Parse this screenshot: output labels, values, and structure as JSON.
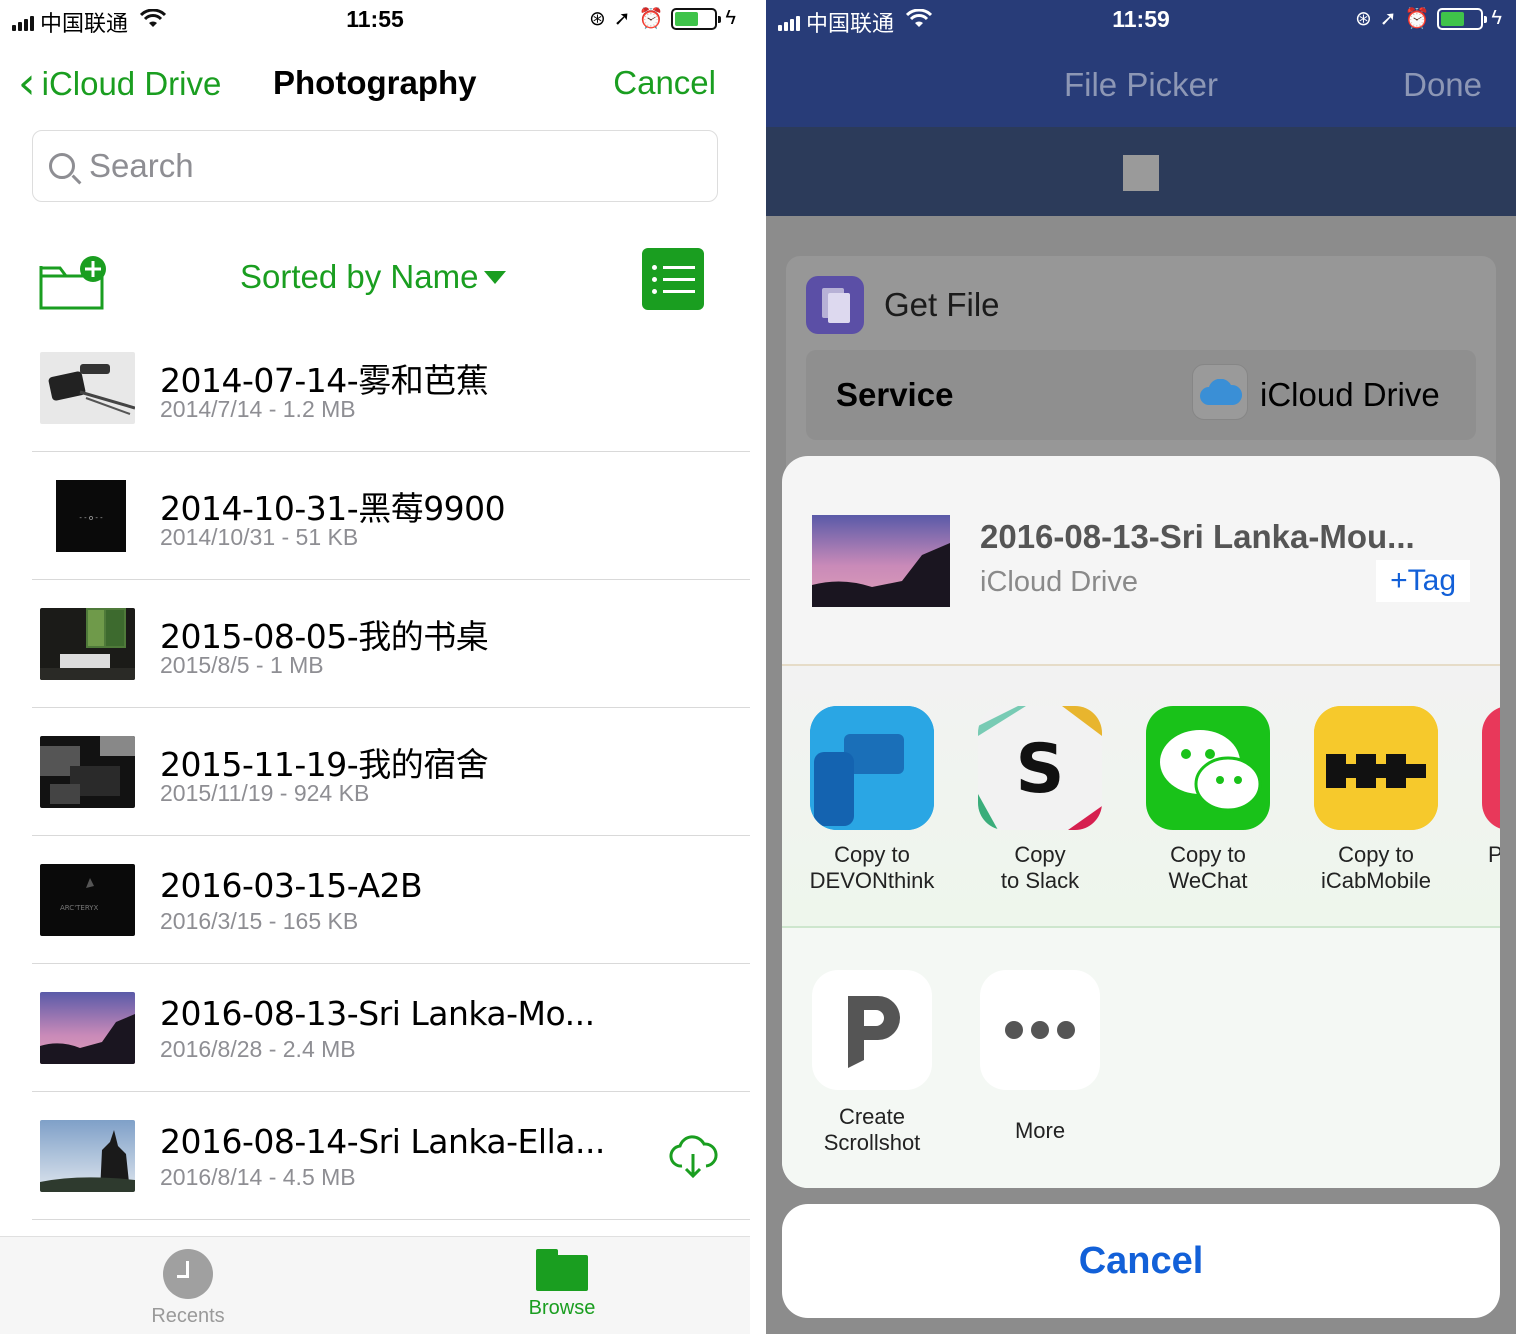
{
  "left": {
    "status": {
      "carrier": "中国联通",
      "time": "11:55"
    },
    "nav": {
      "back_label": "iCloud Drive",
      "title": "Photography",
      "cancel_label": "Cancel"
    },
    "search": {
      "placeholder": "Search"
    },
    "toolbar": {
      "sort_label": "Sorted by Name"
    },
    "files": [
      {
        "name": "2014-07-14-雾和芭蕉",
        "meta": "2014/7/14 - 1.2 MB",
        "thumb": "phones-desk"
      },
      {
        "name": "2014-10-31-黑莓9900",
        "meta": "2014/10/31 - 51 KB",
        "thumb": "black-phone"
      },
      {
        "name": "2015-08-05-我的书桌",
        "meta": "2015/8/5 - 1 MB",
        "thumb": "desk-window"
      },
      {
        "name": "2015-11-19-我的宿舍",
        "meta": "2015/11/19 - 924 KB",
        "thumb": "dorm-desk"
      },
      {
        "name": "2016-03-15-A2B",
        "meta": "2016/3/15 - 165 KB",
        "thumb": "arcteryx"
      },
      {
        "name": "2016-08-13-Sri Lanka-Mo...",
        "meta": "2016/8/28 - 2.4 MB",
        "thumb": "mountain-dusk"
      },
      {
        "name": "2016-08-14-Sri Lanka-Ella...",
        "meta": "2016/8/14 - 4.5 MB",
        "thumb": "ella-sky",
        "icon": "cloud-download-icon"
      }
    ],
    "tabs": [
      {
        "label": "Recents",
        "icon": "clock-icon"
      },
      {
        "label": "Browse",
        "icon": "folder-icon"
      }
    ],
    "colors": {
      "accent": "#1a9e20"
    }
  },
  "right": {
    "status": {
      "carrier": "中国联通",
      "time": "11:59"
    },
    "header": {
      "title": "File Picker",
      "done_label": "Done"
    },
    "card": {
      "action_label": "Get File",
      "service_label": "Service",
      "service_value": "iCloud Drive"
    },
    "sheet": {
      "file_name": "2016-08-13-Sri Lanka-Mou...",
      "file_location": "iCloud Drive",
      "tag_label": "+Tag",
      "apps": [
        {
          "label": "Copy to\nDEVONthink",
          "icon": "devonthink-icon"
        },
        {
          "label": "Copy\nto Slack",
          "icon": "slack-icon"
        },
        {
          "label": "Copy to\nWeChat",
          "icon": "wechat-icon"
        },
        {
          "label": "Copy to\niCabMobile",
          "icon": "icabmobile-icon"
        },
        {
          "label": "P",
          "icon": "partial-app-icon"
        }
      ],
      "actions": [
        {
          "label": "Create\nScrollshot",
          "icon": "scrollshot-icon"
        },
        {
          "label": "More",
          "icon": "more-icon"
        }
      ],
      "cancel_label": "Cancel"
    },
    "colors": {
      "header": "#283c78",
      "link": "#1260d8"
    }
  }
}
